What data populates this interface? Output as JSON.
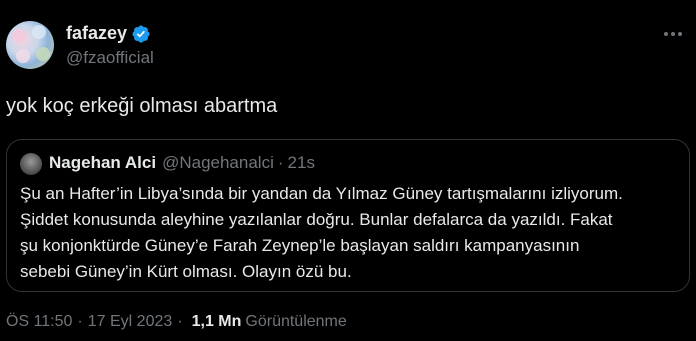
{
  "author": {
    "display_name": "fafazey",
    "handle": "@fzaofficial",
    "verified_icon": "verified-badge-icon"
  },
  "tweet": {
    "text": "yok koç erkeği olması abartma"
  },
  "quoted": {
    "display_name": "Nagehan Alci",
    "handle": "@Nagehanalci",
    "separator": "·",
    "time": "21s",
    "lines": [
      "Şu an Hafter’in Libya’sında bir yandan da Yılmaz Güney tartışmalarını izliyorum.",
      "Şiddet konusunda aleyhine yazılanlar doğru. Bunlar defalarca da yazıldı. Fakat",
      "şu konjonktürde Güney’e Farah Zeynep’le başlayan saldırı kampanyasının",
      "sebebi Güney’in Kürt olması. Olayın özü bu."
    ]
  },
  "meta": {
    "time": "ÖS 11:50",
    "separator": "·",
    "date": "17 Eyl 2023",
    "views_count": "1,1 Mn",
    "views_label": "Görüntülenme"
  },
  "colors": {
    "background": "#000000",
    "text_primary": "#e7e9ea",
    "text_secondary": "#71767b",
    "border": "#2f3336",
    "verified": "#1d9bf0"
  }
}
